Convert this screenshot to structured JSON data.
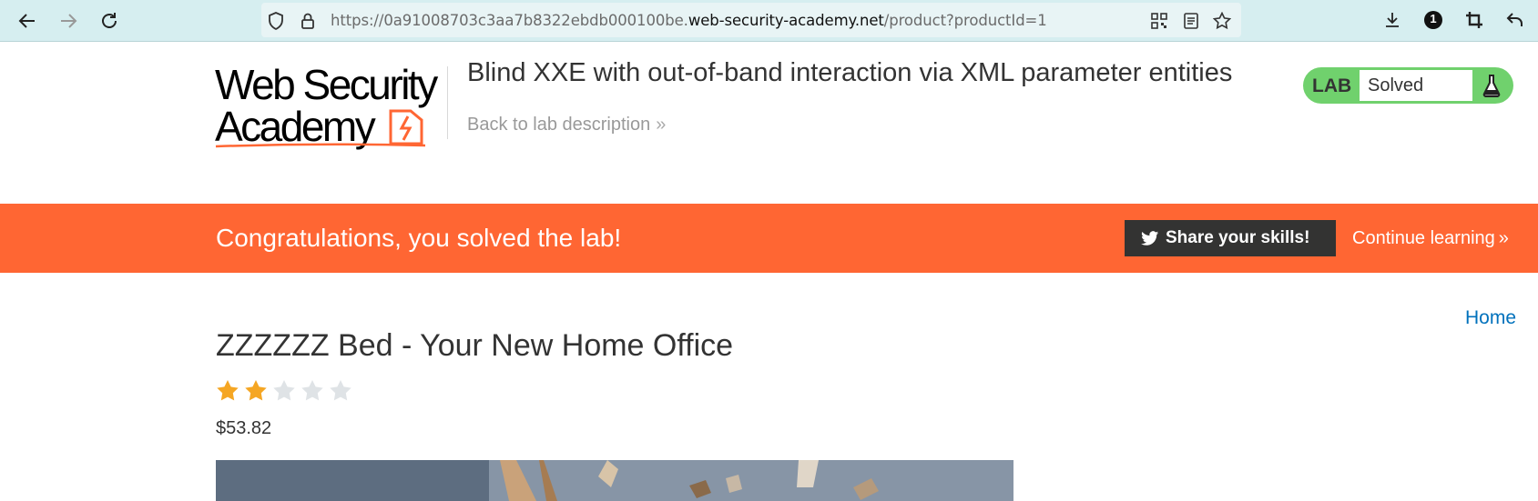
{
  "browser": {
    "url_prefix": "https://0a91008703c3aa7b8322ebdb000100be.",
    "url_host": "web-security-academy.net",
    "url_path": "/product?productId=1",
    "badge_count": "1"
  },
  "header": {
    "logo_line1": "Web Security",
    "logo_line2": "Academy",
    "lab_title": "Blind XXE with out-of-band interaction via XML parameter entities",
    "back_link": "Back to lab description",
    "lab_label": "LAB",
    "lab_state": "Solved"
  },
  "banner": {
    "message": "Congratulations, you solved the lab!",
    "share_label": "Share your skills!",
    "continue_label": "Continue learning"
  },
  "nav": {
    "home_label": "Home"
  },
  "product": {
    "title": "ZZZZZZ Bed - Your New Home Office",
    "rating": 2,
    "rating_max": 5,
    "price": "$53.82"
  },
  "colors": {
    "accent_orange": "#ff6633",
    "lab_green": "#70d16d",
    "star_filled": "#f5a623",
    "star_empty": "#dfe3e6",
    "link_blue": "#0071bc"
  }
}
